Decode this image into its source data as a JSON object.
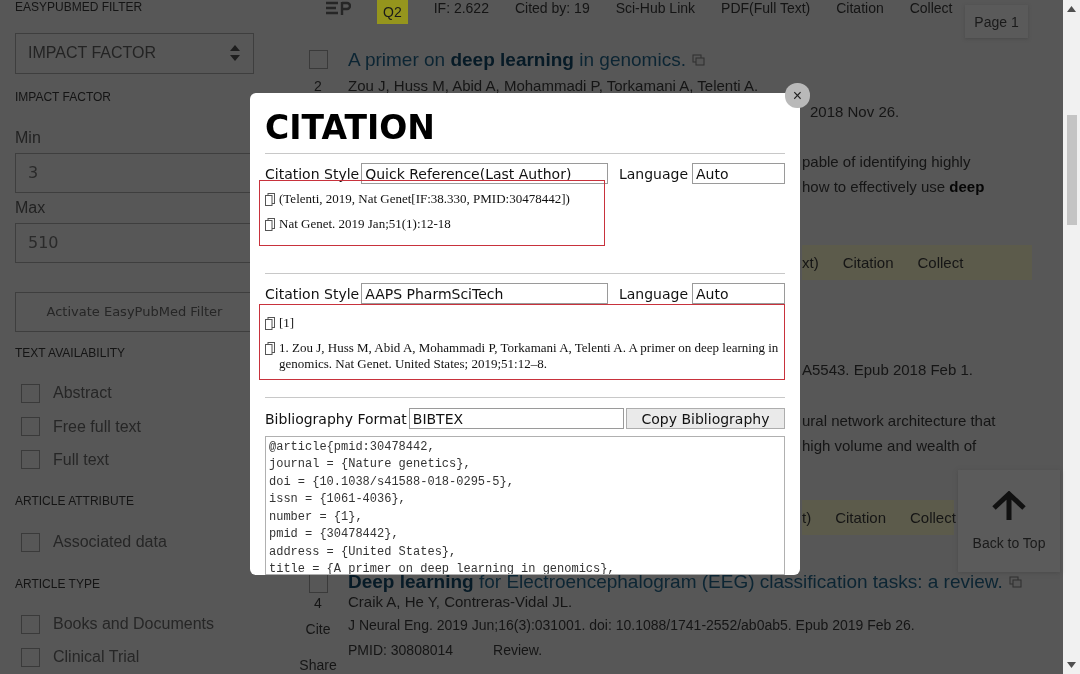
{
  "sidebar": {
    "heading": "EASYPUBMED FILTER",
    "filter": "IMPACT FACTOR",
    "range_label": "IMPACT FACTOR",
    "min_label": "Min",
    "min_value": "3",
    "max_label": "Max",
    "max_value": "510",
    "activate_button": "Activate EasyPubMed Filter",
    "groups": [
      {
        "title": "TEXT AVAILABILITY",
        "options": [
          {
            "label": "Abstract",
            "checked": false
          },
          {
            "label": "Free full text",
            "checked": false
          },
          {
            "label": "Full text",
            "checked": false
          }
        ]
      },
      {
        "title": "ARTICLE ATTRIBUTE",
        "options": [
          {
            "label": "Associated data",
            "checked": false
          }
        ]
      },
      {
        "title": "ARTICLE TYPE",
        "options": [
          {
            "label": "Books and Documents",
            "checked": false
          },
          {
            "label": "Clinical Trial",
            "checked": false
          }
        ]
      }
    ]
  },
  "result_toolbar": [
    {
      "kind": "badge",
      "text": "Q2"
    },
    {
      "kind": "text",
      "text": "IF: 2.622"
    },
    {
      "kind": "link",
      "text": "Cited by: 19"
    },
    {
      "kind": "link",
      "text": "Sci-Hub Link"
    },
    {
      "kind": "link",
      "text": "PDF(Full Text)"
    },
    {
      "kind": "link",
      "text": "Citation"
    },
    {
      "kind": "link",
      "text": "Collect"
    }
  ],
  "page_indicator": "Page 1",
  "result_2": {
    "number": "2",
    "selected": false,
    "title": "A primer on **deep learning** in genomics.",
    "authors": "Zou J, Huss M, Abid A, Mohammadi P, Torkamani A, Telenti A."
  },
  "partly_hidden": [
    {
      "kind": "text",
      "text": "2018 Nov 26."
    },
    {
      "kind": "text",
      "text": "pable of identifying highly"
    },
    {
      "kind": "text",
      "text": "how to effectively use **deep**"
    },
    {
      "kind": "actions",
      "items": [
        "xt)",
        "Citation",
        "Collect"
      ]
    },
    {
      "kind": "text",
      "text": "A5543. Epub 2018 Feb 1."
    },
    {
      "kind": "text",
      "text": "ural network architecture that"
    },
    {
      "kind": "text",
      "text": "high volume and wealth of"
    },
    {
      "kind": "actions",
      "items": [
        "t)",
        "Citation",
        "Collect"
      ]
    }
  ],
  "back_to_top": "Back to Top",
  "result_4": {
    "number": "4",
    "selected": false,
    "title": "**Deep learning** for Electroencephalogram (EEG) classification tasks: a review.",
    "authors": "Craik A, He Y, Contreras-Vidal JL.",
    "cite": "Cite",
    "share": "Share",
    "journal": "J Neural Eng. 2019 Jun;16(3):031001. doi: 10.1088/1741-2552/ab0ab5. Epub 2019 Feb 26.",
    "pmid": "PMID: 30808014",
    "type": "Review."
  },
  "citation_dialog": {
    "title": "CITATION",
    "close": "×",
    "sections": [
      {
        "style_label": "Citation Style",
        "style": "Quick Reference(Last Author)",
        "language_label": "Language",
        "language": "Auto",
        "entries": [
          "(Telenti, 2019, Nat Genet[IF:38.330, PMID:30478442])",
          "Nat Genet. 2019 Jan;51(1):12-18"
        ]
      },
      {
        "style_label": "Citation Style",
        "style": "AAPS PharmSciTech",
        "language_label": "Language",
        "language": "Auto",
        "entries": [
          "[1]",
          "1. Zou J, Huss M, Abid A, Mohammadi P, Torkamani A, Telenti A. A primer on deep learning in genomics. Nat Genet. United States; 2019;51:12–8."
        ]
      }
    ],
    "bibliography": {
      "label": "Bibliography Format",
      "format": "BIBTEX",
      "button": "Copy Bibliography",
      "lines": [
        "@article{pmid:30478442,",
        "journal = {Nature genetics},",
        "doi = {10.1038/s41588-018-0295-5},",
        "issn = {1061-4036},",
        "number = {1},",
        "pmid = {30478442},",
        "address = {United States},",
        "title = {A primer on deep learning in genomics},"
      ]
    }
  }
}
